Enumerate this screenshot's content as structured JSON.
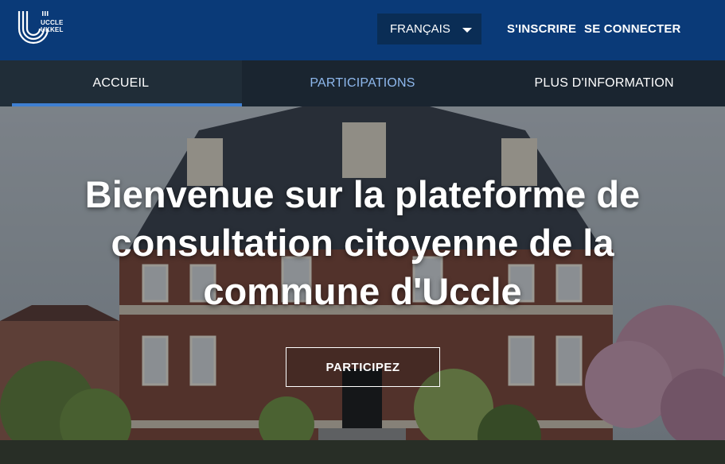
{
  "header": {
    "logo_lines": [
      "UCCLE",
      "UKKEL"
    ],
    "language": "FRANÇAIS",
    "signup": "S'INSCRIRE",
    "login": "SE CONNECTER"
  },
  "nav": {
    "tabs": [
      {
        "label": "ACCUEIL",
        "active": true
      },
      {
        "label": "PARTICIPATIONS",
        "active": false
      },
      {
        "label": "PLUS D'INFORMATION",
        "active": false
      }
    ]
  },
  "hero": {
    "title": "Bienvenue sur la plateforme de consultation citoyenne de la commune d'Uccle",
    "cta": "PARTICIPEZ"
  },
  "colors": {
    "topbar": "#0a3a78",
    "nav": "#1a2530",
    "active_underline": "#3f7fd1",
    "muted_tab": "#8fb9ee"
  }
}
